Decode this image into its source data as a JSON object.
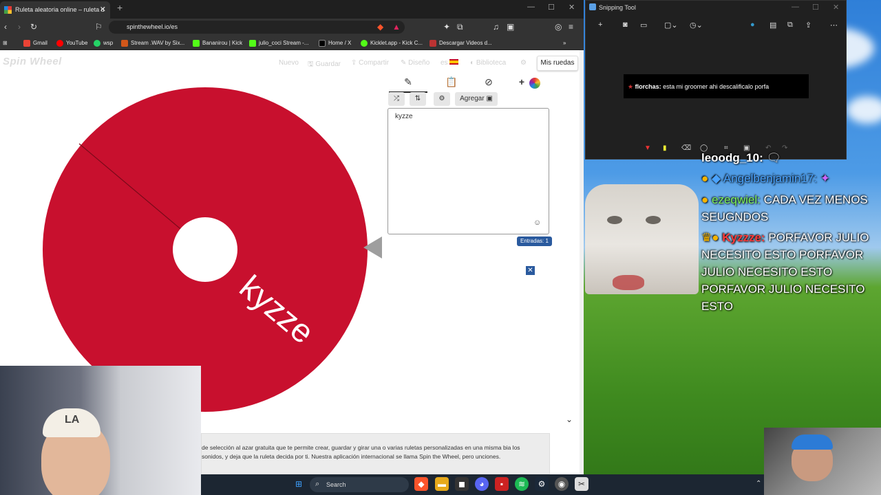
{
  "browser": {
    "tab_title": "Ruleta aleatoria online – ruleta d",
    "url": "spinthewheel.io/es",
    "bookmarks": [
      "Gmail",
      "YouTube",
      "wsp",
      "Stream .WAV by Six...",
      "Bananirou | Kick",
      "julio_coci Stream -...",
      "Home / X",
      "Kicklet.app - Kick C...",
      "Descargar Videos d..."
    ]
  },
  "page": {
    "logo": "Spin Wheel",
    "nav": [
      "Nuevo",
      "Guardar",
      "Compartir",
      "Diseño",
      "es",
      "Biblioteca"
    ],
    "mis_ruedas": "Mis ruedas",
    "wheel_label": "kyzze",
    "wheel_color": "#c8102e",
    "add_button": "Agregar",
    "entries_text": "kyzze",
    "entries_count": "Entradas: 1",
    "description": "de selección al azar gratuita que te permite crear, guardar y girar una o varias ruletas personalizadas en una misma bia los sonidos, y deja que la ruleta decida por ti. Nuestra aplicación internacional se llama Spin the Wheel, pero unciones."
  },
  "snipping": {
    "title": "Snipping Tool",
    "caption_user": "florchas:",
    "caption_text": "esta mi groomer ahi descalificalo porfa"
  },
  "chat": [
    {
      "user": "leoodg_10:",
      "text": ""
    },
    {
      "user": "Angelbenjamin17:",
      "text": ""
    },
    {
      "user": "ezeqwiel:",
      "text": "CADA VEZ MENOS SEUGNDOS"
    },
    {
      "user": "Kyzzze:",
      "text": "PORFAVOR JULIO NECESITO ESTO PORFAVOR JULIO NECESITO ESTO PORFAVOR JULIO NECESITO ESTO"
    }
  ],
  "taskbar": {
    "search": "Search"
  }
}
